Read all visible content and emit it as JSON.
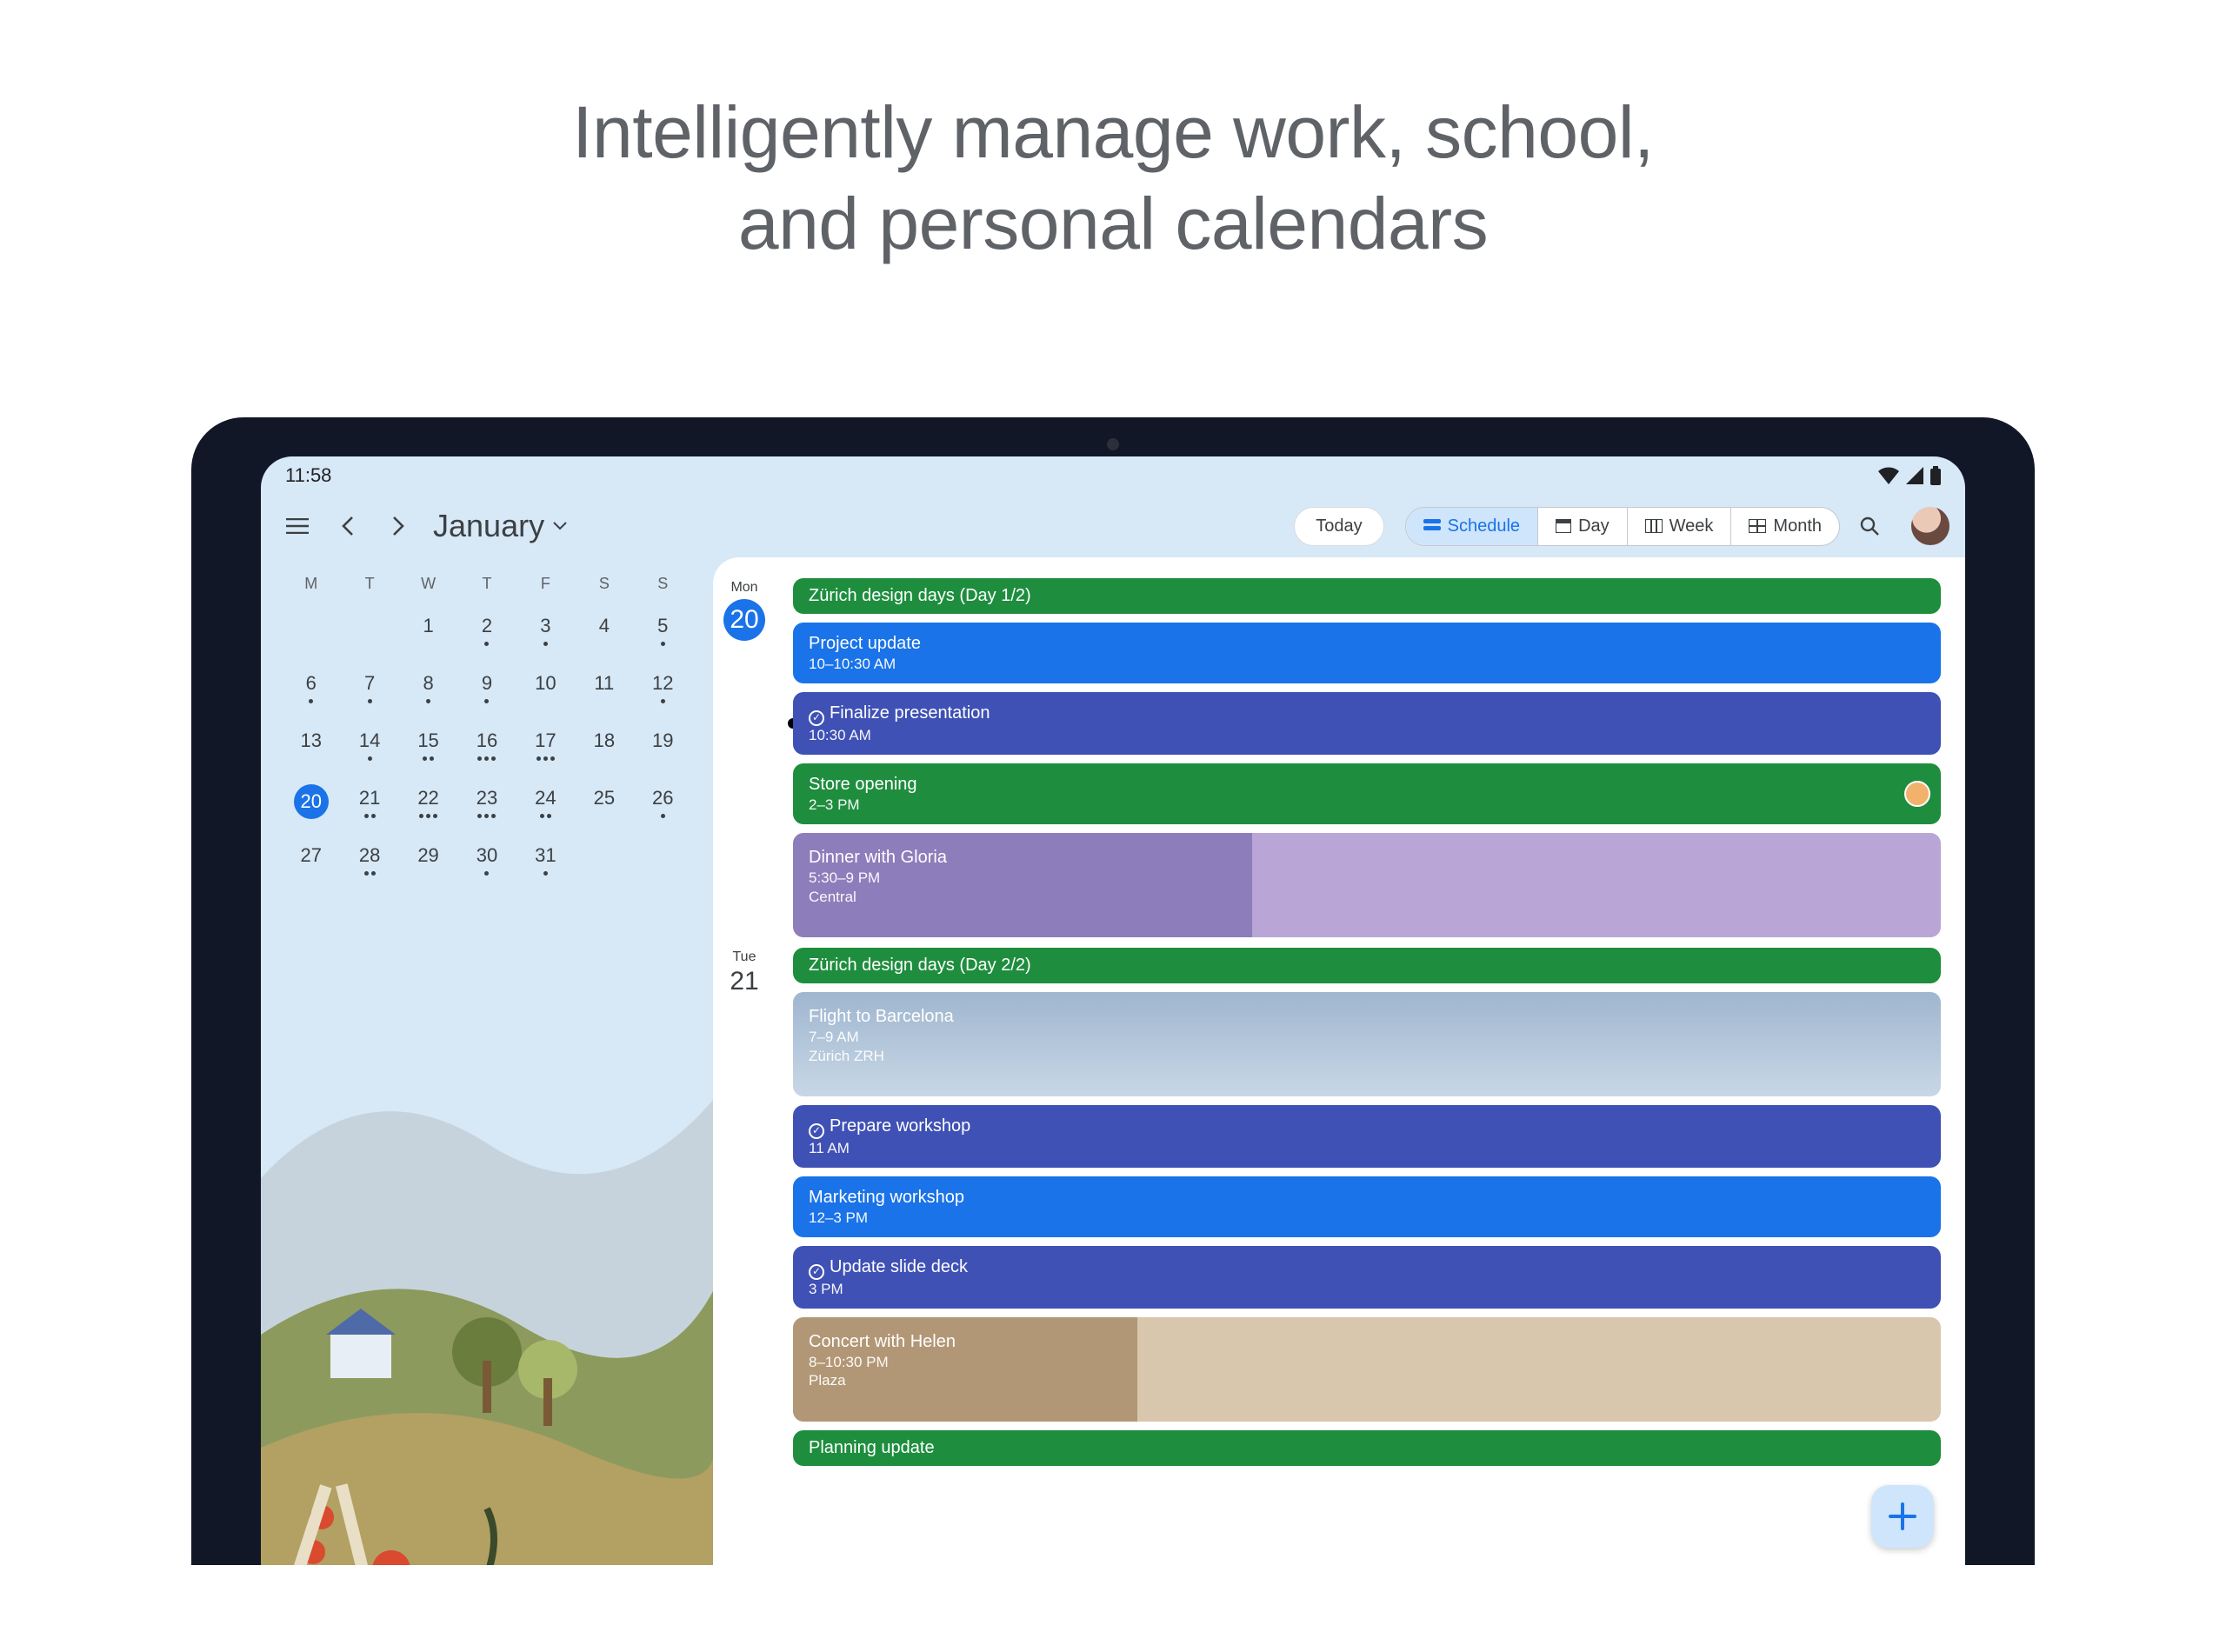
{
  "headline": "Intelligently manage work, school,\nand personal calendars",
  "status": {
    "time": "11:58"
  },
  "appbar": {
    "month": "January",
    "today_label": "Today",
    "views": {
      "schedule": "Schedule",
      "day": "Day",
      "week": "Week",
      "month": "Month"
    }
  },
  "minical": {
    "dow": [
      "M",
      "T",
      "W",
      "T",
      "F",
      "S",
      "S"
    ],
    "weeks": [
      [
        {
          "n": "",
          "d": 0
        },
        {
          "n": "",
          "d": 0
        },
        {
          "n": "1",
          "d": 0
        },
        {
          "n": "2",
          "d": 1
        },
        {
          "n": "3",
          "d": 1
        },
        {
          "n": "4",
          "d": 0
        },
        {
          "n": "5",
          "d": 1
        }
      ],
      [
        {
          "n": "6",
          "d": 1
        },
        {
          "n": "7",
          "d": 1
        },
        {
          "n": "8",
          "d": 1
        },
        {
          "n": "9",
          "d": 1
        },
        {
          "n": "10",
          "d": 0
        },
        {
          "n": "11",
          "d": 0
        },
        {
          "n": "12",
          "d": 1
        }
      ],
      [
        {
          "n": "13",
          "d": 0
        },
        {
          "n": "14",
          "d": 1
        },
        {
          "n": "15",
          "d": 2
        },
        {
          "n": "16",
          "d": 3
        },
        {
          "n": "17",
          "d": 3
        },
        {
          "n": "18",
          "d": 0
        },
        {
          "n": "19",
          "d": 0
        }
      ],
      [
        {
          "n": "20",
          "d": 0,
          "sel": true
        },
        {
          "n": "21",
          "d": 2
        },
        {
          "n": "22",
          "d": 3
        },
        {
          "n": "23",
          "d": 3
        },
        {
          "n": "24",
          "d": 2
        },
        {
          "n": "25",
          "d": 0
        },
        {
          "n": "26",
          "d": 1
        }
      ],
      [
        {
          "n": "27",
          "d": 0
        },
        {
          "n": "28",
          "d": 2
        },
        {
          "n": "29",
          "d": 0
        },
        {
          "n": "30",
          "d": 1
        },
        {
          "n": "31",
          "d": 1
        },
        {
          "n": "",
          "d": 0
        },
        {
          "n": "",
          "d": 0
        }
      ]
    ]
  },
  "schedule": [
    {
      "dow": "Mon",
      "day": "20",
      "active": true,
      "events": [
        {
          "title": "Zürich design days (Day 1/2)",
          "sub": "",
          "cls": "green slim"
        },
        {
          "title": "Project update",
          "sub": "10–10:30 AM",
          "cls": "blue"
        },
        {
          "title": "Finalize presentation",
          "sub": "10:30 AM",
          "cls": "indigo",
          "check": true,
          "now": true
        },
        {
          "title": "Store opening",
          "sub": "2–3 PM",
          "cls": "green",
          "att": true
        },
        {
          "title": "Dinner with Gloria",
          "sub": "5:30–9 PM",
          "sub2": "Central",
          "cls": "dinner tall"
        }
      ]
    },
    {
      "dow": "Tue",
      "day": "21",
      "active": false,
      "events": [
        {
          "title": "Zürich design days (Day 2/2)",
          "sub": "",
          "cls": "green slim"
        },
        {
          "title": "Flight to Barcelona",
          "sub": "7–9 AM",
          "sub2": "Zürich ZRH",
          "cls": "flight tall"
        },
        {
          "title": "Prepare workshop",
          "sub": "11 AM",
          "cls": "indigo",
          "check": true
        },
        {
          "title": "Marketing workshop",
          "sub": "12–3 PM",
          "cls": "blue"
        },
        {
          "title": "Update slide deck",
          "sub": "3 PM",
          "cls": "indigo",
          "check": true
        },
        {
          "title": "Concert with Helen",
          "sub": "8–10:30 PM",
          "sub2": "Plaza",
          "cls": "concert tall"
        },
        {
          "title": "Planning update",
          "sub": "",
          "cls": "planning slim"
        }
      ]
    }
  ]
}
